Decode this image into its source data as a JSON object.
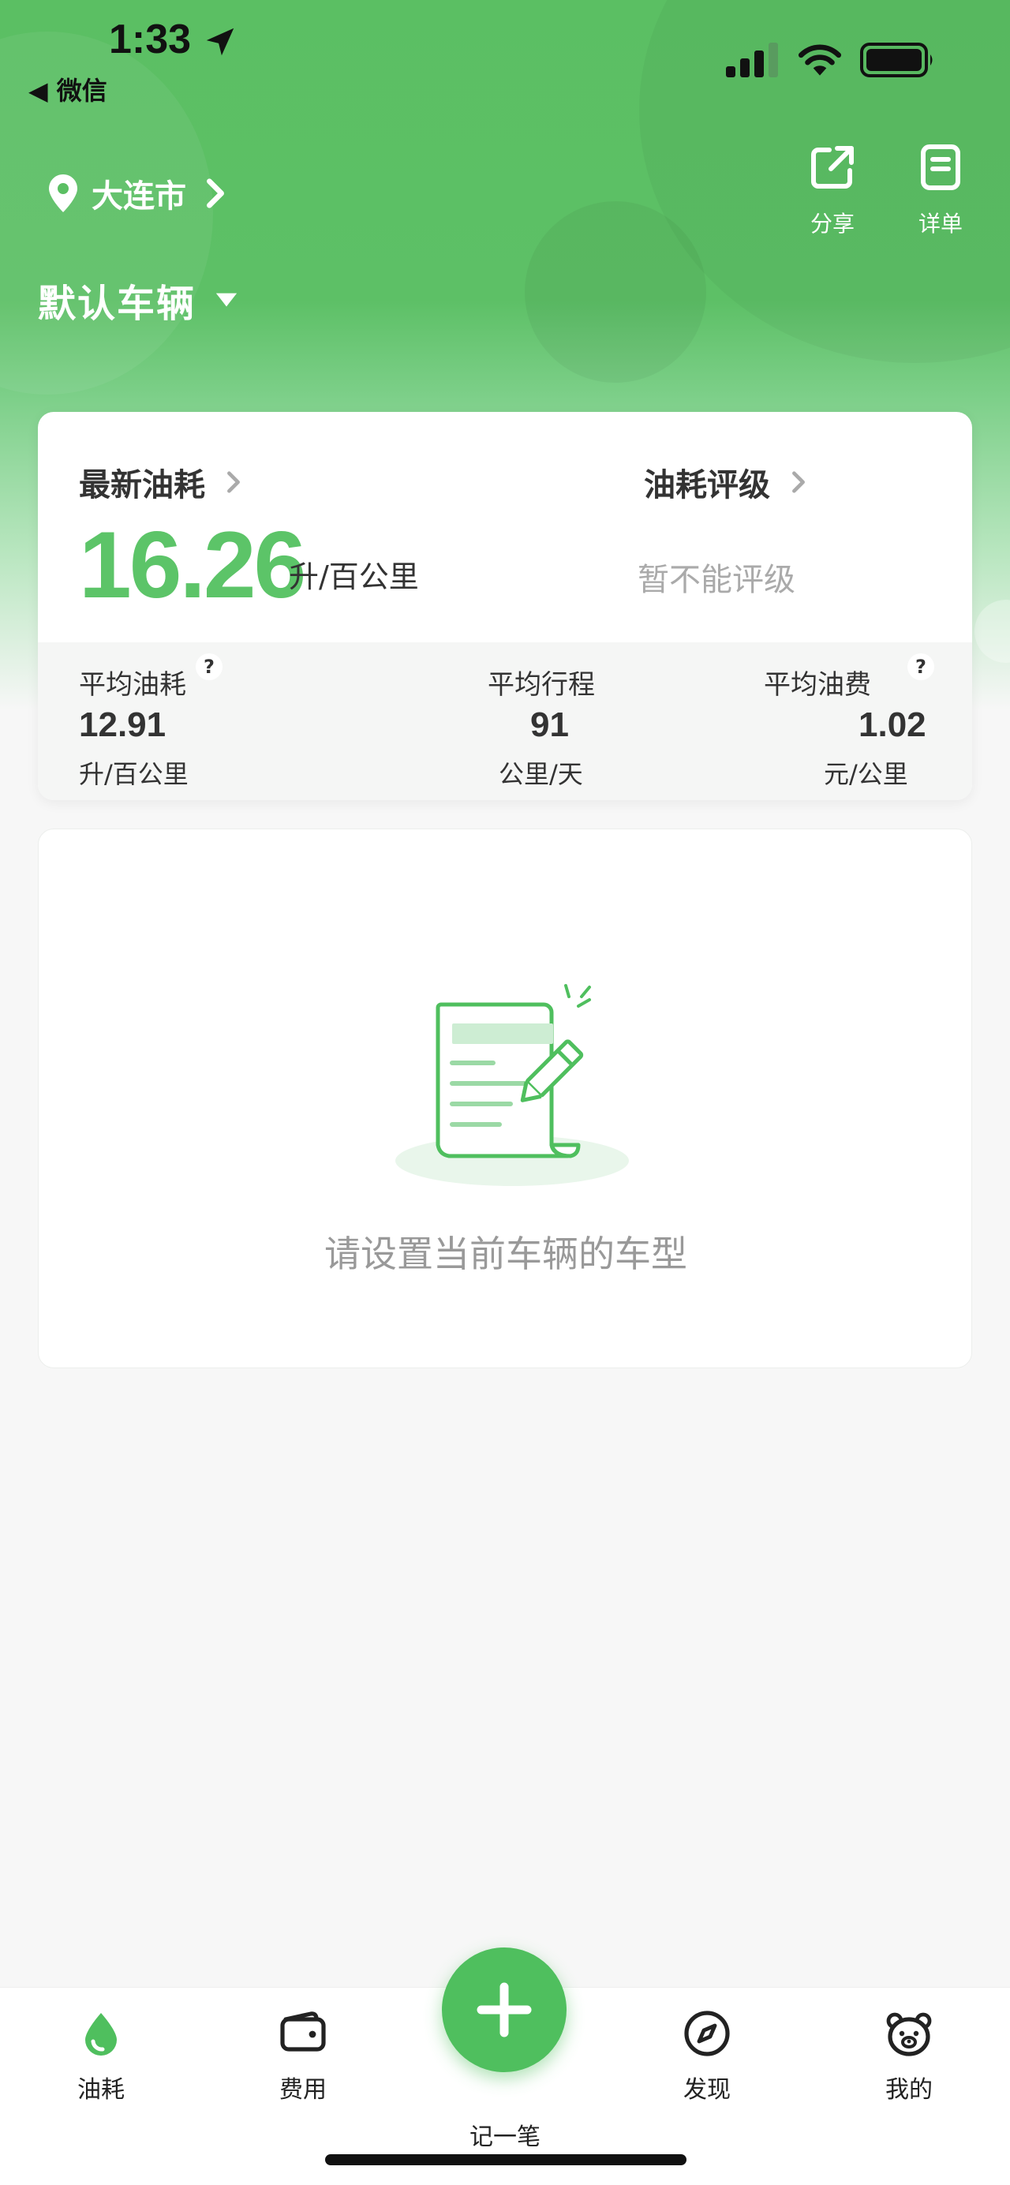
{
  "status_bar": {
    "time": "1:33",
    "back_label": "◀ 微信"
  },
  "header": {
    "city": "大连市",
    "vehicle": "默认车辆",
    "share_label": "分享",
    "detail_label": "详单"
  },
  "fuel_card": {
    "latest_title": "最新油耗",
    "latest_value": "16.26",
    "latest_unit": "升/百公里",
    "rating_title": "油耗评级",
    "rating_text": "暂不能评级",
    "stats": {
      "avg_fuel": {
        "label": "平均油耗",
        "value": "12.91",
        "unit": "升/百公里",
        "help": "?"
      },
      "avg_trip": {
        "label": "平均行程",
        "value": "91",
        "unit": "公里/天"
      },
      "avg_cost": {
        "label": "平均油费",
        "value": "1.02",
        "unit": "元/公里",
        "help": "?"
      }
    }
  },
  "model_card": {
    "message": "请设置当前车辆的车型",
    "illustration_icon": "document-edit-icon"
  },
  "bottom_nav": {
    "items": [
      {
        "label": "油耗",
        "icon": "droplet-icon"
      },
      {
        "label": "费用",
        "icon": "wallet-icon"
      },
      {
        "label": "发现",
        "icon": "compass-icon"
      },
      {
        "label": "我的",
        "icon": "bear-face-icon"
      }
    ],
    "fab_label": "记一笔"
  },
  "colors": {
    "accent": "#5cc468",
    "header_green": "#5bbf63",
    "fab_green": "#4fbf5e"
  }
}
